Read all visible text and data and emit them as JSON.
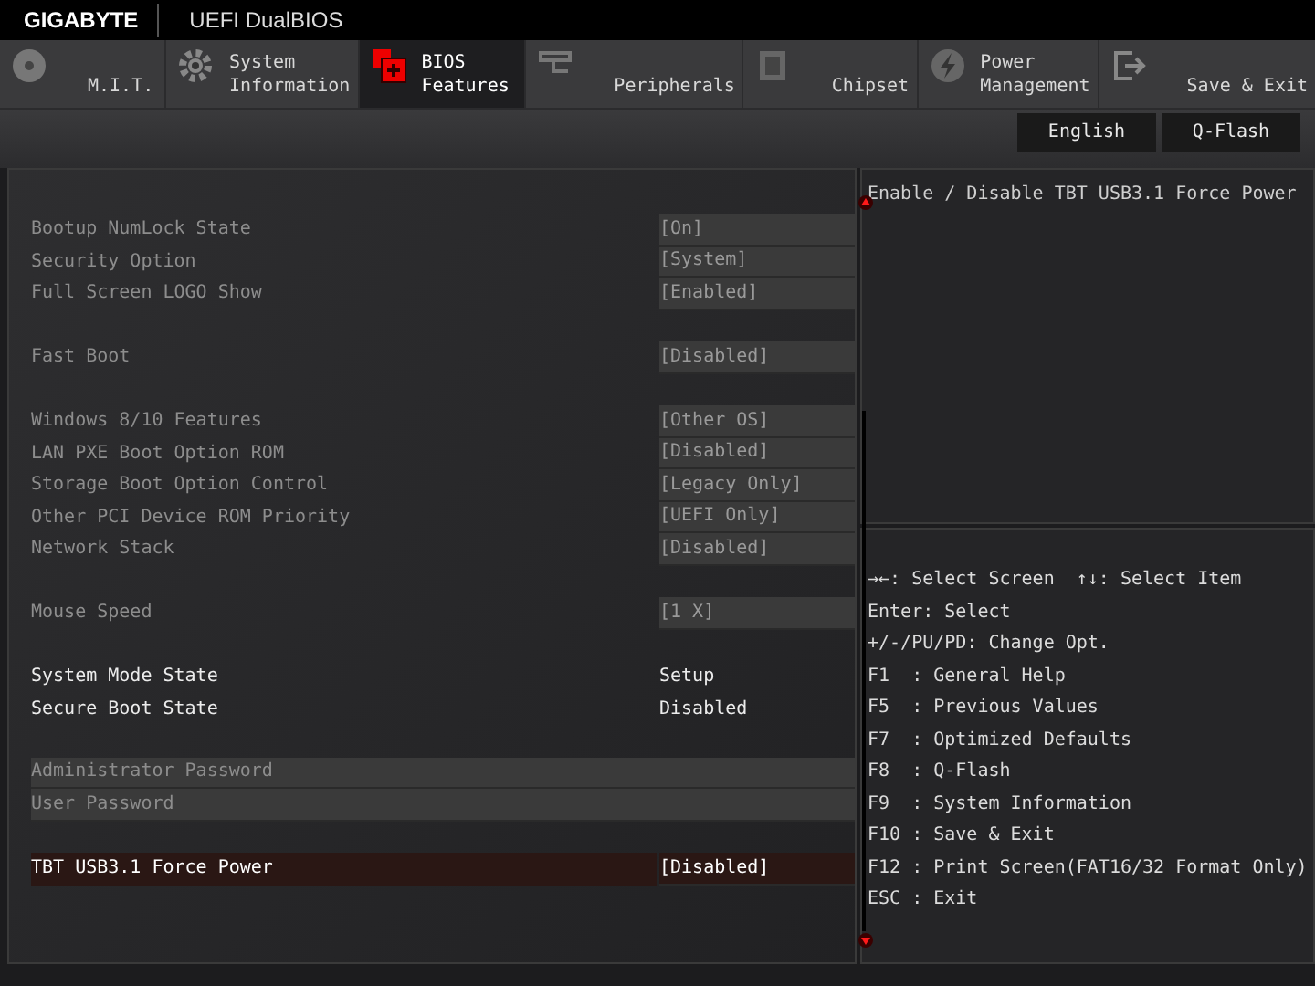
{
  "header": {
    "brand": "GIGABYTE",
    "product": "UEFI DualBIOS"
  },
  "tabs": [
    {
      "lines": [
        "M.I.T."
      ],
      "selected": false
    },
    {
      "lines": [
        "System",
        "Information"
      ],
      "selected": false
    },
    {
      "lines": [
        "BIOS",
        "Features"
      ],
      "selected": true
    },
    {
      "lines": [
        "Peripherals"
      ],
      "selected": false
    },
    {
      "lines": [
        "Chipset"
      ],
      "selected": false
    },
    {
      "lines": [
        "Power",
        "Management"
      ],
      "selected": false
    },
    {
      "lines": [
        "Save & Exit"
      ],
      "selected": false
    }
  ],
  "top_buttons": [
    "English",
    "Q-Flash"
  ],
  "settings": [
    [
      {
        "kind": "option",
        "label": "Bootup NumLock State",
        "value": "[On]",
        "selected": false
      },
      {
        "kind": "option",
        "label": "Security Option",
        "value": "[System]",
        "selected": false
      },
      {
        "kind": "option",
        "label": "Full Screen LOGO Show",
        "value": "[Enabled]",
        "selected": false
      }
    ],
    [
      {
        "kind": "option",
        "label": "Fast Boot",
        "value": "[Disabled]",
        "selected": false
      }
    ],
    [
      {
        "kind": "option",
        "label": "Windows 8/10 Features",
        "value": "[Other OS]",
        "selected": false
      },
      {
        "kind": "option",
        "label": "LAN PXE Boot Option ROM",
        "value": "[Disabled]",
        "selected": false
      },
      {
        "kind": "option",
        "label": "Storage Boot Option Control",
        "value": "[Legacy Only]",
        "selected": false
      },
      {
        "kind": "option",
        "label": "Other PCI Device ROM Priority",
        "value": "[UEFI Only]",
        "selected": false
      },
      {
        "kind": "option",
        "label": "Network Stack",
        "value": "[Disabled]",
        "selected": false
      }
    ],
    [
      {
        "kind": "option",
        "label": "Mouse Speed",
        "value": "[1 X]",
        "selected": false
      }
    ],
    [
      {
        "kind": "info",
        "label": "System Mode State",
        "value": "Setup",
        "selected": false
      },
      {
        "kind": "info",
        "label": "Secure Boot State",
        "value": "Disabled",
        "selected": false
      }
    ],
    [
      {
        "kind": "password",
        "label": "Administrator Password",
        "selected": false
      },
      {
        "kind": "password",
        "label": "User Password",
        "selected": false
      }
    ],
    [
      {
        "kind": "option",
        "label": "TBT USB3.1 Force Power",
        "value": "[Disabled]",
        "selected": true
      }
    ]
  ],
  "help_text": "Enable / Disable TBT USB3.1 Force Power",
  "key_help": [
    "→←: Select Screen  ↑↓: Select Item",
    "Enter: Select",
    "+/-/PU/PD: Change Opt.",
    "F1  : General Help",
    "F5  : Previous Values",
    "F7  : Optimized Defaults",
    "F8  : Q-Flash",
    "F9  : System Information",
    "F10 : Save & Exit",
    "F12 : Print Screen(FAT16/32 Format Only)",
    "ESC : Exit"
  ]
}
